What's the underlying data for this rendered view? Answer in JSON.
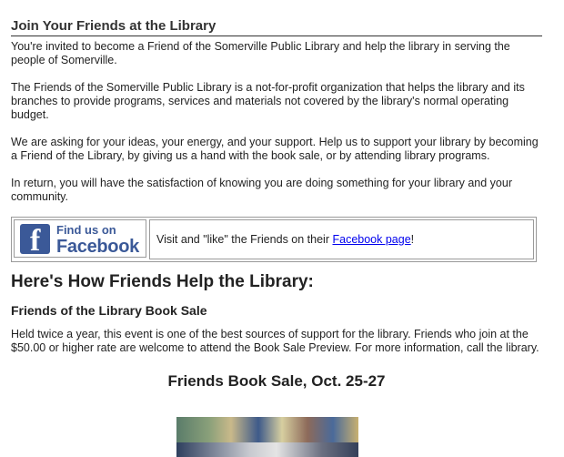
{
  "join": {
    "heading": "Join Your Friends at the Library",
    "paragraphs": [
      "You're invited to become a Friend of the Somerville Public Library and help the library in serving the people of Somerville.",
      "The Friends of the Somerville Public Library is a not-for-profit organization that helps the library and its branches to provide programs, services and materials not covered by the library's normal operating budget.",
      "We are asking for your ideas, your energy, and your support. Help us to support your library by becoming a Friend of the Library, by giving us a hand with the book sale, or by attending library programs.",
      "In return, you will have the satisfaction of knowing you are doing something for your library and your community."
    ]
  },
  "facebook": {
    "logo_line1": "Find us on",
    "logo_line2": "Facebook",
    "logo_letter": "f",
    "text_before": "Visit and \"like\" the Friends on their ",
    "link_text": "Facebook page",
    "text_after": "!",
    "brand_color": "#3b5998"
  },
  "how": {
    "heading": "Here's How Friends Help the Library:",
    "book_sale_heading": "Friends of the Library Book Sale",
    "book_sale_text": "Held twice a year, this event is one of the best sources of support for the library.  Friends who join at the $50.00 or higher rate are welcome to attend the Book Sale Preview. For more information, call the library.",
    "sale_title": "Friends Book Sale, Oct. 25-27"
  }
}
